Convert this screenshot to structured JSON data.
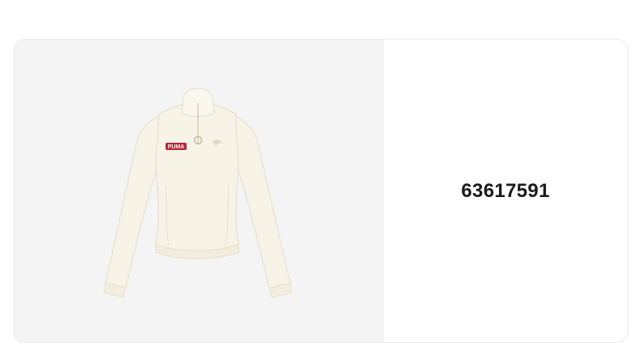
{
  "product": {
    "id": "63617591",
    "image_name": "cream-half-zip-sweatshirt-photo",
    "chest_logo_text": "PUMA"
  },
  "colors": {
    "garment": "#f7f3e6",
    "garment_shadow": "#e6e0cd",
    "logo_red": "#b0283a",
    "image_background": "#f4f4f4"
  }
}
